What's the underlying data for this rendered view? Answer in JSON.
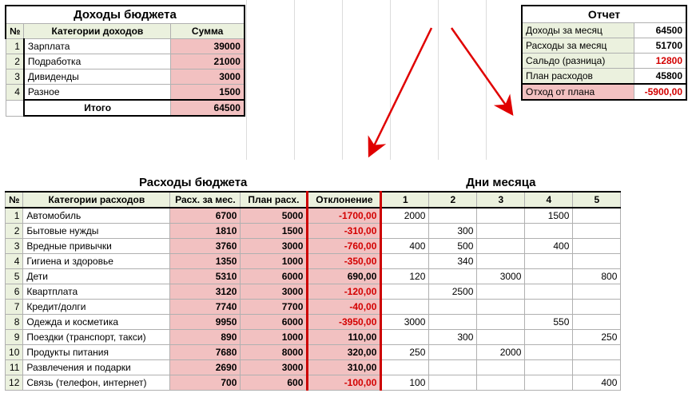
{
  "income": {
    "title": "Доходы бюджета",
    "headers": {
      "num": "№",
      "category": "Категории доходов",
      "sum": "Сумма"
    },
    "rows": [
      {
        "num": "1",
        "category": "Зарплата",
        "sum": "39000"
      },
      {
        "num": "2",
        "category": "Подработка",
        "sum": "21000"
      },
      {
        "num": "3",
        "category": "Дивиденды",
        "sum": "3000"
      },
      {
        "num": "4",
        "category": "Разное",
        "sum": "1500"
      }
    ],
    "total": {
      "label": "Итого",
      "sum": "64500"
    }
  },
  "report": {
    "title": "Отчет",
    "rows": [
      {
        "label": "Доходы за месяц",
        "value": "64500",
        "class": ""
      },
      {
        "label": "Расходы за месяц",
        "value": "51700",
        "class": ""
      },
      {
        "label": "Сальдо (разница)",
        "value": "12800",
        "class": "red"
      },
      {
        "label": "План расходов",
        "value": "45800",
        "class": ""
      },
      {
        "label": "Отход от плана",
        "value": "-5900,00",
        "class": "red deviation thickline"
      }
    ]
  },
  "expenses": {
    "title": "Расходы бюджета",
    "days_title": "Дни месяца",
    "headers": {
      "num": "№",
      "category": "Категории расходов",
      "month": "Расх. за мес.",
      "plan": "План расх.",
      "dev": "Отклонение",
      "days": [
        "1",
        "2",
        "3",
        "4",
        "5"
      ]
    },
    "rows": [
      {
        "num": "1",
        "category": "Автомобиль",
        "month": "6700",
        "plan": "5000",
        "dev": "-1700,00",
        "days": [
          "2000",
          "",
          "",
          "1500",
          ""
        ]
      },
      {
        "num": "2",
        "category": "Бытовые нужды",
        "month": "1810",
        "plan": "1500",
        "dev": "-310,00",
        "days": [
          "",
          "300",
          "",
          "",
          ""
        ]
      },
      {
        "num": "3",
        "category": "Вредные привычки",
        "month": "3760",
        "plan": "3000",
        "dev": "-760,00",
        "days": [
          "400",
          "500",
          "",
          "400",
          ""
        ]
      },
      {
        "num": "4",
        "category": "Гигиена и здоровье",
        "month": "1350",
        "plan": "1000",
        "dev": "-350,00",
        "days": [
          "",
          "340",
          "",
          "",
          ""
        ]
      },
      {
        "num": "5",
        "category": "Дети",
        "month": "5310",
        "plan": "6000",
        "dev": "690,00",
        "days": [
          "120",
          "",
          "3000",
          "",
          "800"
        ]
      },
      {
        "num": "6",
        "category": "Квартплата",
        "month": "3120",
        "plan": "3000",
        "dev": "-120,00",
        "days": [
          "",
          "2500",
          "",
          "",
          ""
        ]
      },
      {
        "num": "7",
        "category": "Кредит/долги",
        "month": "7740",
        "plan": "7700",
        "dev": "-40,00",
        "days": [
          "",
          "",
          "",
          "",
          ""
        ]
      },
      {
        "num": "8",
        "category": "Одежда и косметика",
        "month": "9950",
        "plan": "6000",
        "dev": "-3950,00",
        "days": [
          "3000",
          "",
          "",
          "550",
          ""
        ]
      },
      {
        "num": "9",
        "category": "Поездки (транспорт, такси)",
        "month": "890",
        "plan": "1000",
        "dev": "110,00",
        "days": [
          "",
          "300",
          "",
          "",
          "250"
        ]
      },
      {
        "num": "10",
        "category": "Продукты питания",
        "month": "7680",
        "plan": "8000",
        "dev": "320,00",
        "days": [
          "250",
          "",
          "2000",
          "",
          ""
        ]
      },
      {
        "num": "11",
        "category": "Развлечения и подарки",
        "month": "2690",
        "plan": "3000",
        "dev": "310,00",
        "days": [
          "",
          "",
          "",
          "",
          ""
        ]
      },
      {
        "num": "12",
        "category": "Связь (телефон, интернет)",
        "month": "700",
        "plan": "600",
        "dev": "-100,00",
        "days": [
          "100",
          "",
          "",
          "",
          "400"
        ]
      }
    ]
  }
}
